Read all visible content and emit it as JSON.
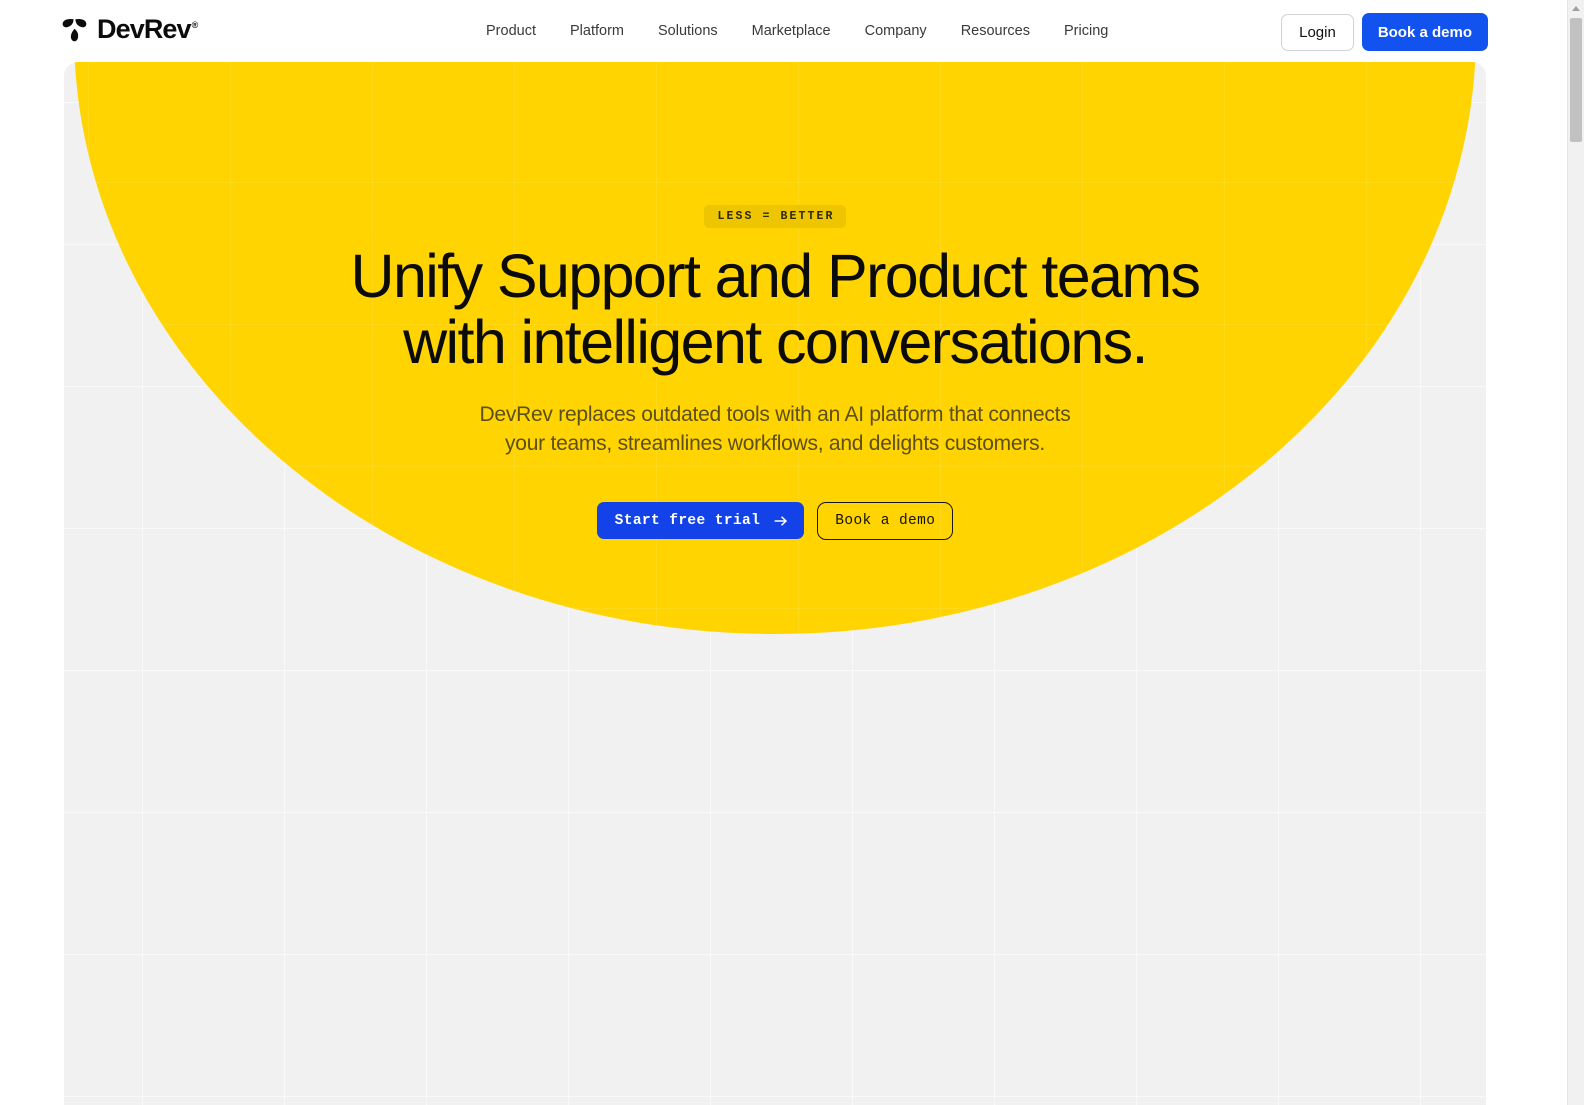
{
  "header": {
    "brand": {
      "name": "DevRev",
      "trademark": "®",
      "logo_icon": "devrev-pinwheel-logo"
    },
    "nav_items": [
      {
        "label": "Product"
      },
      {
        "label": "Platform"
      },
      {
        "label": "Solutions"
      },
      {
        "label": "Marketplace"
      },
      {
        "label": "Company"
      },
      {
        "label": "Resources"
      },
      {
        "label": "Pricing"
      }
    ],
    "login_label": "Login",
    "demo_label": "Book a demo"
  },
  "hero": {
    "eyebrow": "LESS = BETTER",
    "title_line_1": "Unify Support and Product teams",
    "title_line_2": "with intelligent conversations.",
    "subtitle": "DevRev replaces outdated tools with an AI platform that connects your teams, streamlines workflows, and delights customers.",
    "primary_cta": "Start free trial",
    "primary_cta_icon": "arrow-right-icon",
    "secondary_cta": "Book a demo"
  },
  "colors": {
    "hero_yellow": "#ffd400",
    "eyebrow_bg": "#edc500",
    "brand_blue": "#1252ef",
    "cta_blue": "#1242e8",
    "page_bg": "#f1f1f1",
    "text_dark": "#0b0b0c",
    "subtitle_text": "#5c4f17"
  },
  "scrollbar": {
    "up_arrow_icon": "caret-up-icon",
    "thumb_label": "vertical-scroll-thumb"
  }
}
